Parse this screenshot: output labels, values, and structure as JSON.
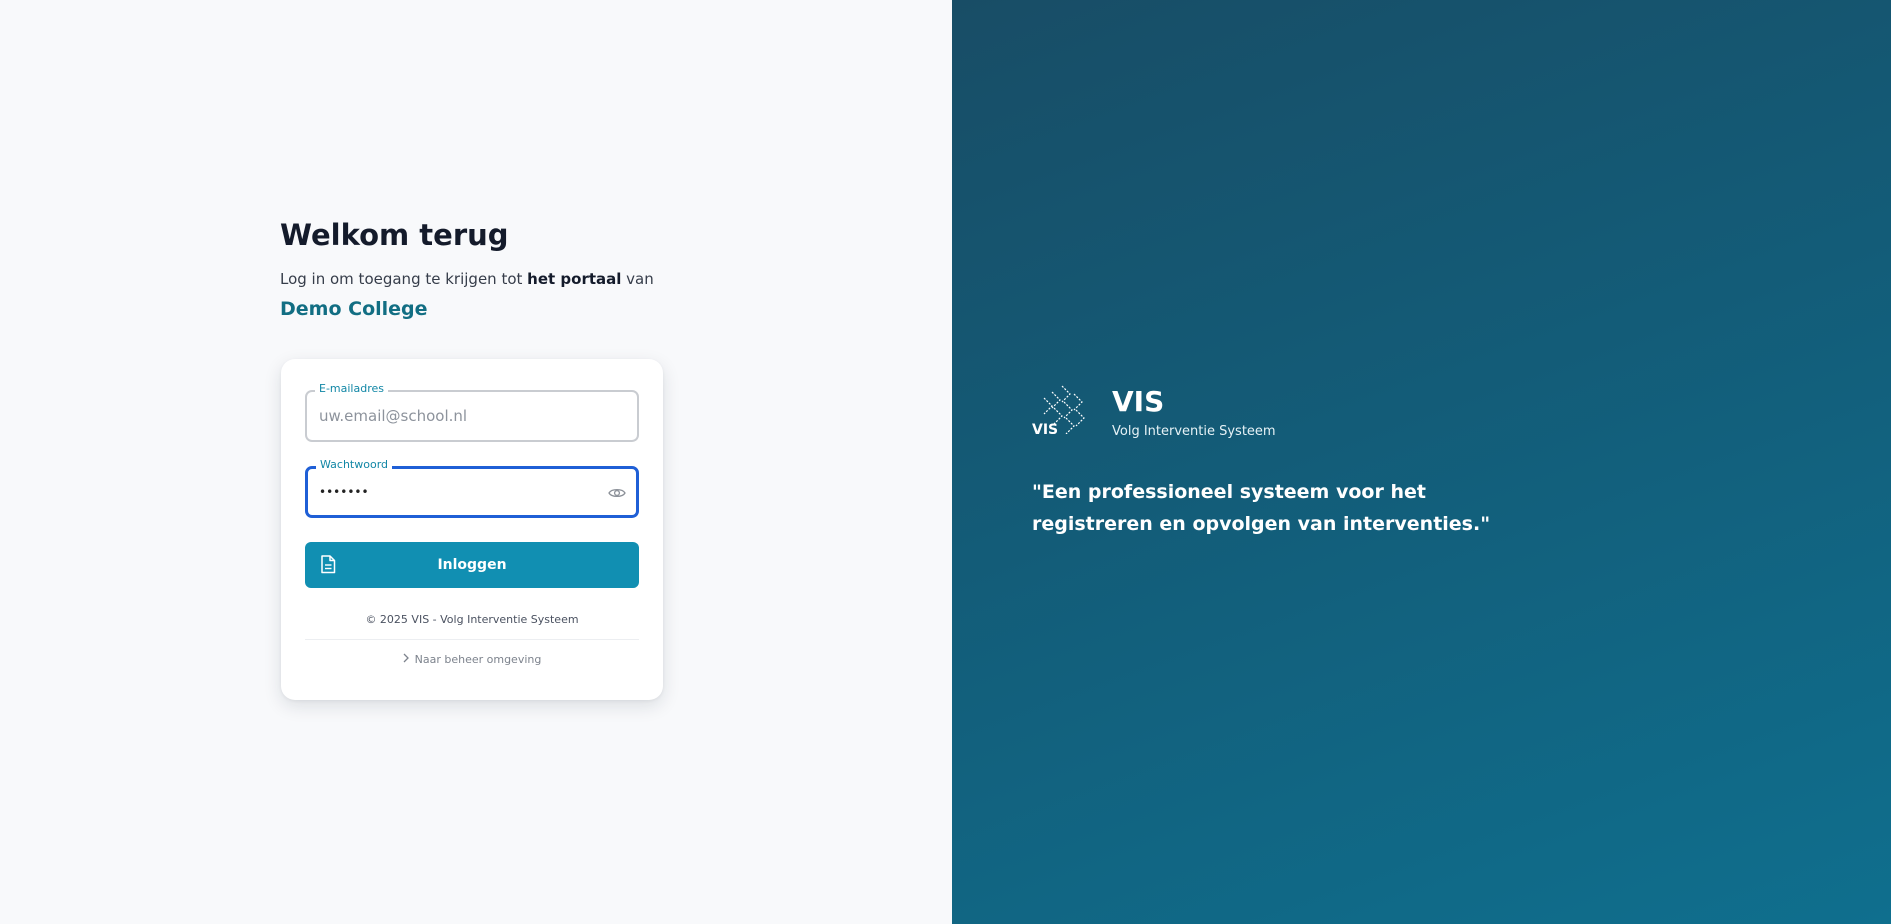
{
  "login": {
    "heading": "Welkom terug",
    "subtitle_pre": "Log in om toegang te krijgen tot ",
    "subtitle_bold": "het portaal",
    "subtitle_post": " van",
    "school_name": "Demo College",
    "email_label": "E-mailadres",
    "email_placeholder": "uw.email@school.nl",
    "email_value": "",
    "password_label": "Wachtwoord",
    "password_value": "•••••••",
    "login_button": "Inloggen",
    "copyright": "© 2025 VIS - Volg Interventie Systeem",
    "admin_link": "Naar beheer omgeving"
  },
  "brand": {
    "logo_text": "VIS",
    "name": "VIS",
    "subtitle": "Volg Interventie Systeem",
    "quote": "\"Een professioneel systeem voor het registreren en opvolgen van interventies.\""
  },
  "icons": {
    "eye": "eye-icon",
    "document": "document-icon",
    "chevron": "chevron-right-icon",
    "logo": "vis-logo"
  },
  "colors": {
    "accent": "#118fb2",
    "school": "#126e83",
    "focus": "#1f5fd6",
    "panel": "#135c78"
  }
}
